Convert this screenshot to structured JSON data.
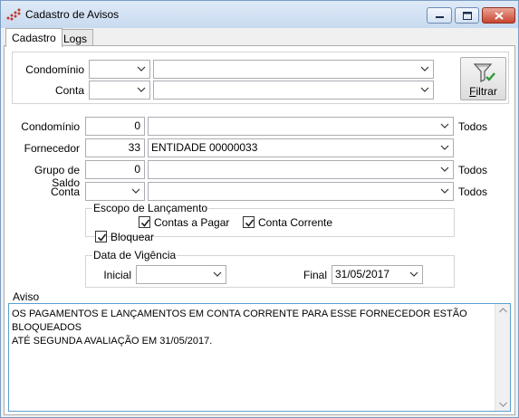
{
  "window": {
    "title": "Cadastro de Avisos"
  },
  "tabs": [
    {
      "label": "Cadastro",
      "active": true
    },
    {
      "label": "Logs",
      "active": false
    }
  ],
  "filter": {
    "condominio_label": "Condomínio",
    "conta_label": "Conta",
    "condominio_code": "",
    "condominio_name": "",
    "conta_code": "",
    "conta_name": "",
    "button_label": "Filtrar"
  },
  "form": {
    "condominio_label": "Condomínio",
    "condominio_code": "0",
    "condominio_name": "",
    "condominio_all": "Todos",
    "fornecedor_label": "Fornecedor",
    "fornecedor_code": "33",
    "fornecedor_name": "ENTIDADE 00000033",
    "grupo_label": "Grupo de Saldo",
    "grupo_code": "0",
    "grupo_name": "",
    "grupo_all": "Todos",
    "conta_label": "Conta",
    "conta_code": "",
    "conta_name": "",
    "conta_all": "Todos"
  },
  "escopo": {
    "title": "Escopo de Lançamento",
    "contas_pagar_label": "Contas a Pagar",
    "contas_pagar_checked": true,
    "conta_corrente_label": "Conta Corrente",
    "conta_corrente_checked": true
  },
  "bloquear": {
    "label": "Bloquear",
    "checked": true
  },
  "vigencia": {
    "title": "Data de Vigência",
    "inicial_label": "Inicial",
    "inicial_value": "",
    "final_label": "Final",
    "final_value": "31/05/2017"
  },
  "aviso": {
    "title": "Aviso",
    "text": "OS PAGAMENTOS E LANÇAMENTOS EM CONTA CORRENTE PARA ESSE FORNECEDOR ESTÃO BLOQUEADOS\nATÉ SEGUNDA AVALIAÇÃO EM 31/05/2017."
  },
  "colors": {
    "title_bar": "#c8daf0",
    "close_button": "#c9452f",
    "focus_border": "#5aa0d0"
  }
}
